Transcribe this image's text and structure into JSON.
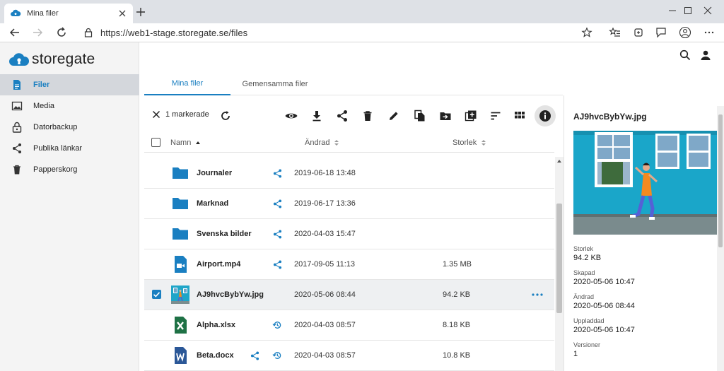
{
  "browser": {
    "tab_title": "Mina filer",
    "url": "https://web1-stage.storegate.se/files"
  },
  "app": {
    "logo_text": "storegate",
    "brand_color": "#1a7fc1"
  },
  "sidebar": {
    "items": [
      {
        "label": "Filer",
        "icon": "file-icon",
        "active": true
      },
      {
        "label": "Media",
        "icon": "image-icon",
        "active": false
      },
      {
        "label": "Datorbackup",
        "icon": "lock-icon",
        "active": false
      },
      {
        "label": "Publika länkar",
        "icon": "share-icon",
        "active": false
      },
      {
        "label": "Papperskorg",
        "icon": "trash-icon",
        "active": false
      }
    ]
  },
  "tabs": [
    {
      "label": "Mina filer",
      "active": true
    },
    {
      "label": "Gemensamma filer",
      "active": false
    }
  ],
  "actionbar": {
    "selection_label": "1 markerade"
  },
  "columns": {
    "name": "Namn",
    "modified": "Ändrad",
    "size": "Storlek"
  },
  "files": [
    {
      "name": "Journaler",
      "type": "folder",
      "shared": true,
      "history": false,
      "modified": "2019-06-18 13:48",
      "size": "",
      "selected": false
    },
    {
      "name": "Marknad",
      "type": "folder",
      "shared": true,
      "history": false,
      "modified": "2019-06-17 13:36",
      "size": "",
      "selected": false
    },
    {
      "name": "Svenska bilder",
      "type": "folder",
      "shared": true,
      "history": false,
      "modified": "2020-04-03 15:47",
      "size": "",
      "selected": false
    },
    {
      "name": "Airport.mp4",
      "type": "video",
      "shared": true,
      "history": false,
      "modified": "2017-09-05 11:13",
      "size": "1.35 MB",
      "selected": false
    },
    {
      "name": "AJ9hvcBybYw.jpg",
      "type": "image",
      "shared": false,
      "history": false,
      "modified": "2020-05-06 08:44",
      "size": "94.2 KB",
      "selected": true
    },
    {
      "name": "Alpha.xlsx",
      "type": "excel",
      "shared": false,
      "history": true,
      "modified": "2020-04-03 08:57",
      "size": "8.18 KB",
      "selected": false
    },
    {
      "name": "Beta.docx",
      "type": "word",
      "shared": true,
      "history": true,
      "modified": "2020-04-03 08:57",
      "size": "10.8 KB",
      "selected": false
    }
  ],
  "details": {
    "title": "AJ9hvcBybYw.jpg",
    "fields": [
      {
        "key": "Storlek",
        "value": "94.2 KB"
      },
      {
        "key": "Skapad",
        "value": "2020-05-06 10:47"
      },
      {
        "key": "Ändrad",
        "value": "2020-05-06 08:44"
      },
      {
        "key": "Uppladdad",
        "value": "2020-05-06 10:47"
      },
      {
        "key": "Versioner",
        "value": "1"
      }
    ]
  }
}
